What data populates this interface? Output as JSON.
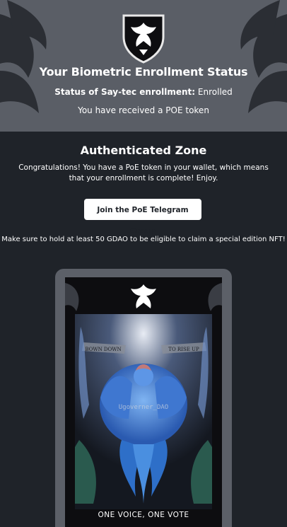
{
  "header": {
    "title": "Your Biometric Enrollment Status",
    "status_label": "Status of Say-tec enrollment:",
    "status_value": "Enrolled",
    "poe_message": "You have received a POE token"
  },
  "zone": {
    "title": "Authenticated Zone",
    "message": "Congratulations! You have a PoE token in your wallet, which means that your enrollment is complete! Enjoy.",
    "telegram_button": "Join the PoE Telegram Group",
    "gdao_note": "Make sure to hold at least 50 GDAO to be eligible to claim a special edition NFT!"
  },
  "nft": {
    "banner_left": "BOWN DOWN",
    "banner_right": "TO RISE UP",
    "watermark": "Ugoverner_DAO",
    "caption": "ONE VOICE, ONE VOTE"
  },
  "colors": {
    "header_bg": "#5a5e66",
    "page_bg": "#1f2329",
    "phoenix_blue": "#4a8fe0"
  },
  "icons": [
    "phoenix-shield-icon",
    "wing-left-icon",
    "wing-right-icon",
    "phoenix-emblem-icon"
  ]
}
